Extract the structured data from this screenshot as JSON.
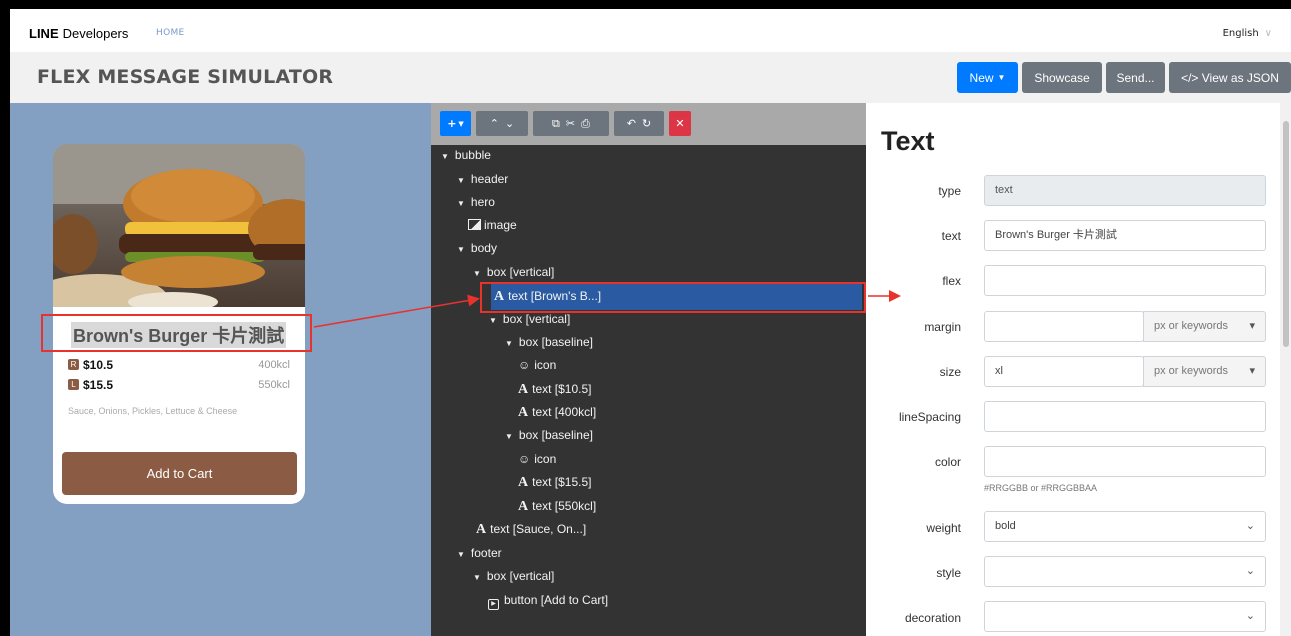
{
  "topnav": {
    "brand_line": "LINE",
    "brand_dev": "Developers",
    "home": "HOME",
    "language": "English"
  },
  "header": {
    "title": "FLEX MESSAGE SIMULATOR",
    "new_label": "New",
    "showcase_label": "Showcase",
    "send_label": "Send...",
    "json_label": "</> View as JSON"
  },
  "preview": {
    "card_title": "Brown's Burger 卡片測試",
    "rows": [
      {
        "icon": "R",
        "price": "$10.5",
        "kcal": "400kcl"
      },
      {
        "icon": "L",
        "price": "$15.5",
        "kcal": "550kcl"
      }
    ],
    "description": "Sauce, Onions, Pickles, Lettuce & Cheese",
    "button": "Add to Cart"
  },
  "tree": {
    "nodes": [
      {
        "label": "bubble",
        "kind": "toggle"
      },
      {
        "label": "header",
        "kind": "toggle"
      },
      {
        "label": "hero",
        "kind": "toggle"
      },
      {
        "label": "image",
        "kind": "image"
      },
      {
        "label": "body",
        "kind": "toggle"
      },
      {
        "label": "box [vertical]",
        "kind": "toggle"
      },
      {
        "label": "text [Brown's B...]",
        "kind": "text"
      },
      {
        "label": "box [vertical]",
        "kind": "toggle"
      },
      {
        "label": "box [baseline]",
        "kind": "toggle"
      },
      {
        "label": "icon",
        "kind": "icon"
      },
      {
        "label": "text [$10.5]",
        "kind": "text"
      },
      {
        "label": "text [400kcl]",
        "kind": "text"
      },
      {
        "label": "box [baseline]",
        "kind": "toggle"
      },
      {
        "label": "icon",
        "kind": "icon"
      },
      {
        "label": "text [$15.5]",
        "kind": "text"
      },
      {
        "label": "text [550kcl]",
        "kind": "text"
      },
      {
        "label": "text [Sauce, On...]",
        "kind": "text"
      },
      {
        "label": "footer",
        "kind": "toggle"
      },
      {
        "label": "box [vertical]",
        "kind": "toggle"
      },
      {
        "label": "button [Add to Cart]",
        "kind": "button"
      }
    ]
  },
  "props": {
    "title": "Text",
    "fields": {
      "type_label": "type",
      "type_value": "text",
      "text_label": "text",
      "text_value": "Brown's Burger 卡片測試",
      "flex_label": "flex",
      "flex_value": "",
      "margin_label": "margin",
      "margin_value": "",
      "margin_addon": "px or keywords",
      "size_label": "size",
      "size_value": "xl",
      "size_addon": "px or keywords",
      "linespacing_label": "lineSpacing",
      "linespacing_value": "",
      "color_label": "color",
      "color_value": "",
      "color_hint": "#RRGGBB or #RRGGBBAA",
      "weight_label": "weight",
      "weight_value": "bold",
      "style_label": "style",
      "style_value": "",
      "decoration_label": "decoration",
      "decoration_value": ""
    }
  },
  "colors": {
    "accent_blue": "#007bff",
    "secondary": "#6c757d",
    "danger": "#dc3545",
    "brown": "#8c5b43",
    "highlight_red": "#e8322c",
    "selected_node": "#2a5ba2"
  }
}
